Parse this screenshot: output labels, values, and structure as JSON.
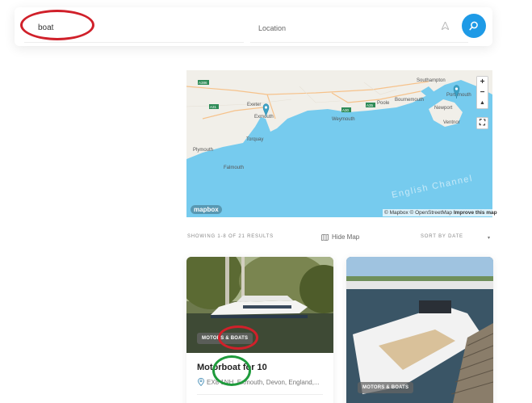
{
  "search": {
    "keyword_value": "boat",
    "location_placeholder": "Location"
  },
  "map": {
    "places": [
      "Exeter",
      "Exmouth",
      "Torquay",
      "Plymouth",
      "Falmouth",
      "Weymouth",
      "Poole",
      "Southampton",
      "Portsmouth",
      "Newport",
      "Ventnor",
      "Bournemouth"
    ],
    "roads": [
      "A386",
      "A30",
      "A35",
      "A31"
    ],
    "sea_label": "English Channel",
    "logo": "mapbox",
    "attribution": "© Mapbox © OpenStreetMap",
    "improve_link": "Improve this map",
    "zoom_in": "+",
    "zoom_out": "−",
    "compass": "▲",
    "fullscreen": "⛶",
    "colors": {
      "sea": "#76cbee",
      "land": "#f1efe9",
      "marker": "#3ba0c4"
    }
  },
  "results": {
    "count_text": "SHOWING 1-8 OF 21 RESULTS",
    "hide_map_label": "Hide Map",
    "sort_label": "SORT BY  DATE"
  },
  "listings": [
    {
      "category": "MOTORS & BOATS",
      "title": "Motorboat for 10",
      "location": "EX8 1NH, Exmouth, Devon, England,..."
    },
    {
      "category": "MOTORS & BOATS"
    }
  ],
  "annotations": {
    "red": "#d0202a",
    "green": "#1f9b3c"
  }
}
